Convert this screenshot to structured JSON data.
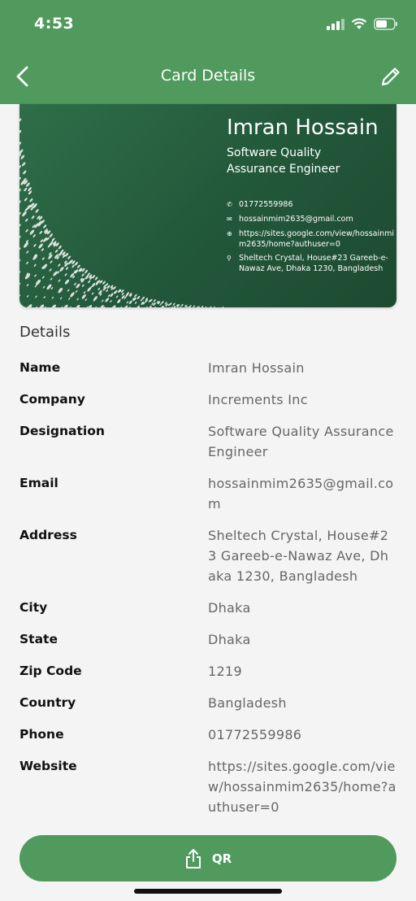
{
  "status_bar": {
    "time": "4:53"
  },
  "header": {
    "title": "Card Details"
  },
  "card": {
    "name": "Imran Hossain",
    "role_line1": "Software Quality",
    "role_line2": "Assurance Engineer",
    "phone": "01772559986",
    "email": "hossainmim2635@gmail.com",
    "website": "https://sites.google.com/view/hossainmim2635/home?authuser=0",
    "address": "Sheltech Crystal, House#23 Gareeb-e-Nawaz Ave, Dhaka 1230, Bangladesh"
  },
  "details": {
    "title": "Details",
    "rows": [
      {
        "label": "Name",
        "value": "Imran Hossain"
      },
      {
        "label": "Company",
        "value": "Increments Inc"
      },
      {
        "label": "Designation",
        "value": "Software Quality Assurance Engineer"
      },
      {
        "label": "Email",
        "value": "hossainmim2635@gmail.com"
      },
      {
        "label": "Address",
        "value": "Sheltech Crystal, House#23 Gareeb-e-Nawaz Ave, Dhaka 1230, Bangladesh"
      },
      {
        "label": "City",
        "value": "Dhaka"
      },
      {
        "label": "State",
        "value": "Dhaka"
      },
      {
        "label": "Zip Code",
        "value": "1219"
      },
      {
        "label": "Country",
        "value": "Bangladesh"
      },
      {
        "label": "Phone",
        "value": "01772559986"
      },
      {
        "label": "Website",
        "value": "https://sites.google.com/view/hossainmim2635/home?authuser=0"
      }
    ]
  },
  "qr_button": {
    "label": "QR"
  },
  "colors": {
    "primary": "#4f9a5c",
    "card_dark": "#1d4a30"
  }
}
